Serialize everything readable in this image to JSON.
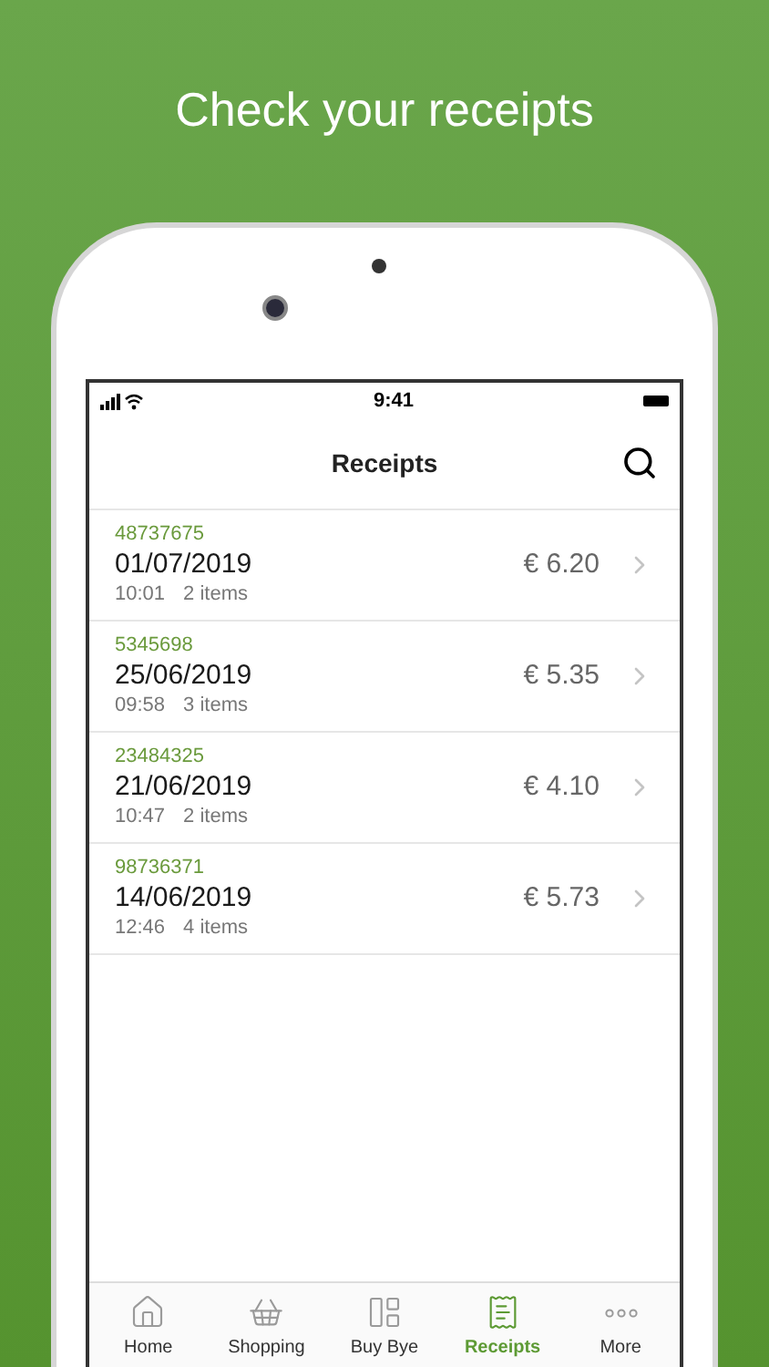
{
  "headline": "Check your receipts",
  "status_bar": {
    "time": "9:41"
  },
  "nav": {
    "title": "Receipts"
  },
  "receipts": [
    {
      "number": "48737675",
      "date": "01/07/2019",
      "time": "10:01",
      "items": "2 items",
      "amount": "€ 6.20"
    },
    {
      "number": "5345698",
      "date": "25/06/2019",
      "time": "09:58",
      "items": "3 items",
      "amount": "€ 5.35"
    },
    {
      "number": "23484325",
      "date": "21/06/2019",
      "time": "10:47",
      "items": "2 items",
      "amount": "€ 4.10"
    },
    {
      "number": "98736371",
      "date": "14/06/2019",
      "time": "12:46",
      "items": "4 items",
      "amount": "€ 5.73"
    }
  ],
  "tabs": [
    {
      "kind": "home",
      "label": "Home",
      "selected": false
    },
    {
      "kind": "shopping",
      "label": "Shopping",
      "selected": false
    },
    {
      "kind": "shelf",
      "label": "Buy Bye",
      "selected": false
    },
    {
      "kind": "receipts",
      "label": "Receipts",
      "selected": true
    },
    {
      "kind": "more",
      "label": "More",
      "selected": false
    }
  ]
}
